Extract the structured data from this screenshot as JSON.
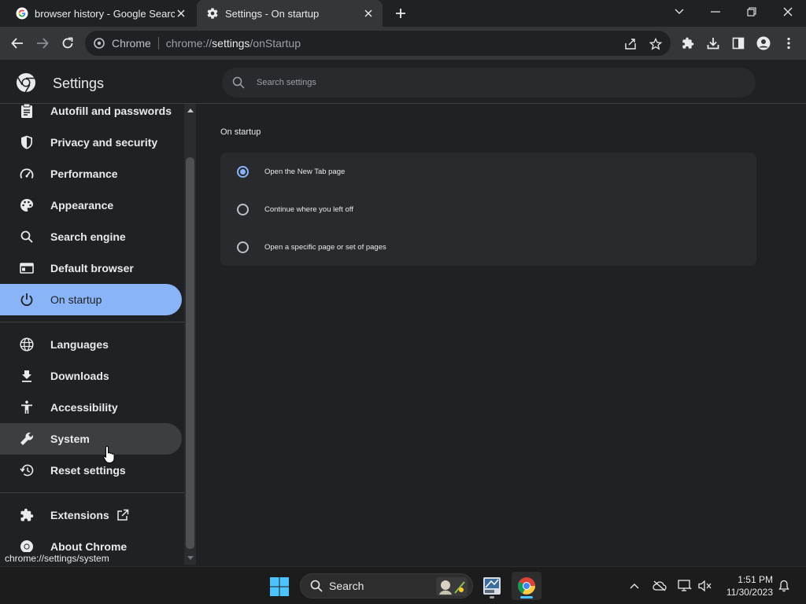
{
  "browser": {
    "tabs": [
      {
        "title": "browser history - Google Search",
        "favicon": "google-g-icon",
        "active": false
      },
      {
        "title": "Settings - On startup",
        "favicon": "gear-icon",
        "active": true
      }
    ],
    "omnibox": {
      "site_chip": "Chrome",
      "url_scheme": "chrome://",
      "url_host": "settings",
      "url_path": "/onStartup"
    }
  },
  "settings": {
    "title": "Settings",
    "search_placeholder": "Search settings",
    "nav": [
      {
        "label": "Autofill and passwords",
        "icon": "clipboard-icon"
      },
      {
        "label": "Privacy and security",
        "icon": "shield-icon"
      },
      {
        "label": "Performance",
        "icon": "speedometer-icon"
      },
      {
        "label": "Appearance",
        "icon": "palette-icon"
      },
      {
        "label": "Search engine",
        "icon": "search-icon"
      },
      {
        "label": "Default browser",
        "icon": "browser-window-icon"
      },
      {
        "label": "On startup",
        "icon": "power-icon",
        "selected": true
      },
      {
        "label": "Languages",
        "icon": "globe-icon"
      },
      {
        "label": "Downloads",
        "icon": "download-icon"
      },
      {
        "label": "Accessibility",
        "icon": "accessibility-icon"
      },
      {
        "label": "System",
        "icon": "wrench-icon",
        "hovered": true
      },
      {
        "label": "Reset settings",
        "icon": "history-reset-icon"
      },
      {
        "label": "Extensions",
        "icon": "puzzle-icon"
      },
      {
        "label": "About Chrome",
        "icon": "chrome-logo-icon"
      }
    ],
    "status_url": "chrome://settings/system",
    "section_title": "On startup",
    "startup_options": [
      {
        "label": "Open the New Tab page",
        "checked": true
      },
      {
        "label": "Continue where you left off",
        "checked": false
      },
      {
        "label": "Open a specific page or set of pages",
        "checked": false
      }
    ]
  },
  "taskbar": {
    "search_label": "Search",
    "time": "1:51 PM",
    "date": "11/30/2023"
  },
  "colors": {
    "accent": "#8ab4f8",
    "background": "#202124",
    "surface": "#292a2d",
    "toolbar": "#35363a"
  }
}
